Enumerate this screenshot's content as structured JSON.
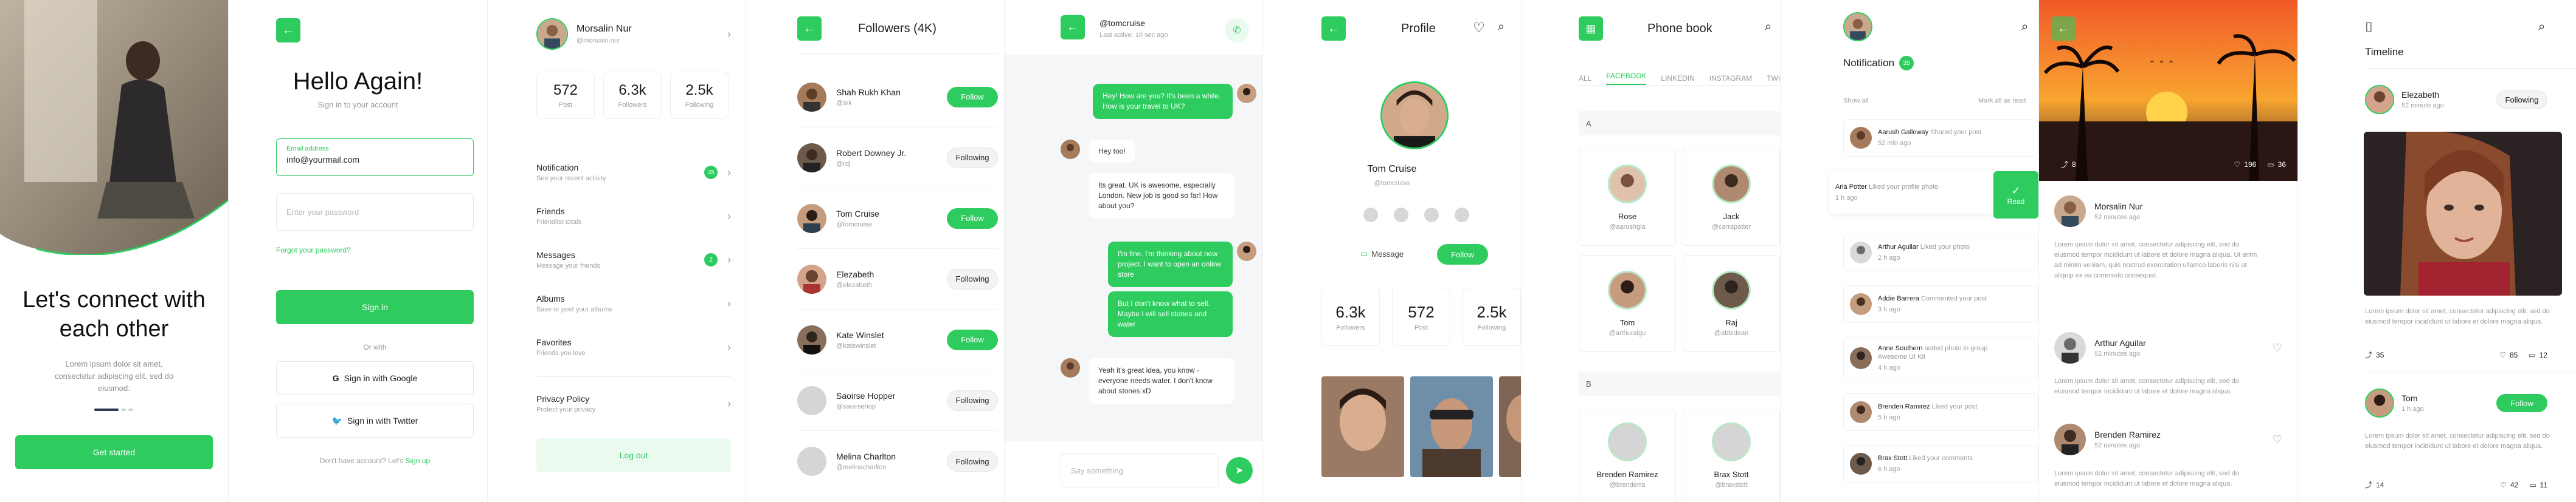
{
  "onboarding": {
    "title": "Let's connect with each other",
    "desc": "Lorem ipsum dolor sit amet, consectetur adipiscing elit, sed do eiusmod.",
    "cta": "Get started",
    "colors": {
      "accent": "#2ecc5f"
    }
  },
  "login": {
    "heading": "Hello Again!",
    "sub": "Sign in to your account",
    "email_label": "Email address",
    "email_value": "info@yourmail.com",
    "password_placeholder": "Enter your password",
    "forgot": "Forgot your password?",
    "signin": "Sign in",
    "or": "Or with",
    "google": "Sign in with Google",
    "twitter": "Sign in with Twitter",
    "footer_q": "Don't have account? Let's",
    "signup": "Sign up"
  },
  "menu": {
    "name": "Morsalin Nur",
    "handle": "@morsalin.nur",
    "stats": [
      {
        "value": "572",
        "label": "Post"
      },
      {
        "value": "6.3k",
        "label": "Followers"
      },
      {
        "value": "2.5k",
        "label": "Following"
      }
    ],
    "items": [
      {
        "title": "Notification",
        "sub": "See your recent activity",
        "badge": "35"
      },
      {
        "title": "Friends",
        "sub": "Friendlist totals",
        "badge": ""
      },
      {
        "title": "Messages",
        "sub": "Message your friends",
        "badge": "2"
      },
      {
        "title": "Albums",
        "sub": "Save or post your albums",
        "badge": ""
      },
      {
        "title": "Favorites",
        "sub": "Friends you love",
        "badge": ""
      }
    ],
    "privacy": {
      "title": "Privacy Policy",
      "sub": "Protect your privacy"
    },
    "logout": "Log out"
  },
  "followers": {
    "title": "Followers (4K)",
    "people": [
      {
        "name": "Shah Rukh Khan",
        "handle": "@srk",
        "action": "Follow"
      },
      {
        "name": "Robert Downey Jr.",
        "handle": "@rdj",
        "action": "Following"
      },
      {
        "name": "Tom Cruise",
        "handle": "@tomcruise",
        "action": "Follow"
      },
      {
        "name": "Elezabeth",
        "handle": "@elezabeth",
        "action": "Following"
      },
      {
        "name": "Kate Winslet",
        "handle": "@katewinslet",
        "action": "Follow"
      },
      {
        "name": "Saoirse Hopper",
        "handle": "@saoirsehop",
        "action": "Following"
      },
      {
        "name": "Melina Charlton",
        "handle": "@melinacharlton",
        "action": "Following"
      }
    ]
  },
  "chat": {
    "user": "@tomcruise",
    "status": "Last active: 10 sec ago",
    "messages": [
      {
        "side": "right",
        "text": "Hey! How are you? It's been a while. How is your travel to UK?"
      },
      {
        "side": "left",
        "text": "Hey too!"
      },
      {
        "side": "left",
        "text": "Its great. UK is awesome, especially London. New job is good so far! How about you?"
      },
      {
        "side": "right",
        "text": "I'm fine. I'm thinking about new project. I want to open an online store"
      },
      {
        "side": "right",
        "text": "But I don't know what to sell. Maybe I will sell stones and water"
      },
      {
        "side": "left",
        "text": "Yeah it's great idea, you know - everyone needs water. I don't know about stones xD"
      }
    ],
    "placeholder": "Say something"
  },
  "profile": {
    "title": "Profile",
    "name": "Tom Cruise",
    "handle": "@tomcruise",
    "message": "Message",
    "follow": "Follow",
    "stats": [
      {
        "value": "6.3k",
        "label": "Followers"
      },
      {
        "value": "572",
        "label": "Post"
      },
      {
        "value": "2.5k",
        "label": "Following"
      }
    ]
  },
  "phonebook": {
    "title": "Phone book",
    "tabs": [
      "ALL",
      "FACEBOOK",
      "LINKEDIN",
      "INSTAGRAM",
      "TWITTE"
    ],
    "sectionA": "A",
    "contactsA": [
      {
        "name": "Rose",
        "handle": "@aarushgia"
      },
      {
        "name": "Jack",
        "handle": "@carrapatter"
      },
      {
        "name": "Tom",
        "handle": "@arthuralgu"
      },
      {
        "name": "Raj",
        "handle": "@abbidean"
      }
    ],
    "sectionB": "B",
    "contactsB": [
      {
        "name": "Brenden Ramirez",
        "handle": "@brenderra"
      },
      {
        "name": "Brax Stott",
        "handle": "@braxstott"
      }
    ]
  },
  "notification": {
    "title": "Notification",
    "badge": "35",
    "show_all": "Show all",
    "mark": "Mark all as read",
    "read": "Read",
    "items": [
      {
        "name": "Aarush Galloway",
        "text": "Shared your post",
        "time": "52 min ago"
      },
      {
        "name": "Aria Potter",
        "text": "Liked your profile photo",
        "time": "1 h ago"
      },
      {
        "name": "Arthur Aguilar",
        "text": "Liked your photo",
        "time": "2 h ago"
      },
      {
        "name": "Addie Barrera",
        "text": "Commented your post",
        "time": "3 h ago"
      },
      {
        "name": "Anne Southern",
        "text": "added photo in group Awesome UI Kit",
        "time": "4 h ago"
      },
      {
        "name": "Brenden Ramirez",
        "text": "Liked your post",
        "time": "5 h ago"
      },
      {
        "name": "Brax Stott",
        "text": "Liked your comments",
        "time": "6 h ago"
      }
    ]
  },
  "feed": {
    "stats": {
      "shares": "8",
      "likes": "196",
      "comments": "36"
    },
    "posts": [
      {
        "name": "Morsalin Nur",
        "time": "52 minutes ago",
        "text": "Lorem ipsum dolor sit amet, consectetur adipiscing elit, sed do eiusmod tempor incididunt ut labore et dolore magna aliqua. Ut enim ad minim veniam, quis nostrud exercitation ullamco laboris nisi ut aliquip ex ea commodo consequat."
      },
      {
        "name": "Arthur Aguilar",
        "time": "52 minutes ago",
        "text": "Lorem ipsum dolor sit amet, consectetur adipiscing elit, sed do eiusmod tempor incididunt ut labore et dolore magna aliqua."
      },
      {
        "name": "Brenden Ramirez",
        "time": "52 minutes ago",
        "text": "Lorem ipsum dolor sit amet, consectetur adipiscing elit, sed do eiusmod tempor incididunt ut labore et dolore magna aliqua."
      }
    ]
  },
  "timeline": {
    "title": "Timeline",
    "post": {
      "name": "Elezabeth",
      "time": "52 minute ago",
      "follow": "Following",
      "text": "Lorem ipsum dolor sit amet, consectetur adipiscing elit, sed do eiusmod tempor incididunt ut labore et dolore magna aliqua.",
      "shares": "35",
      "likes": "85",
      "comments": "12"
    },
    "post2": {
      "name": "Tom",
      "time": "1 h ago",
      "follow": "Follow",
      "text": "Lorem ipsum dolor sit amet, consectetur adipiscing elit, sed do eiusmod tempor incididunt ut labore et dolore magna aliqua.",
      "shares": "14",
      "likes": "42",
      "comments": "11"
    }
  }
}
